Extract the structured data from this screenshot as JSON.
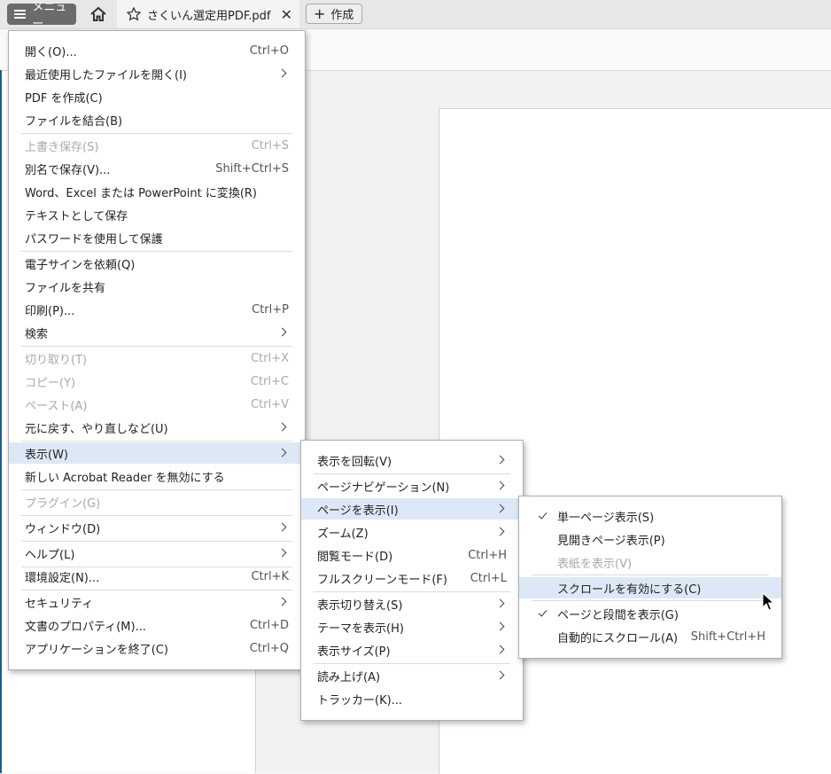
{
  "tabbar": {
    "menu_label": "メニュー",
    "tab_title": "さくいん選定用PDF.pdf",
    "close_glyph": "✕",
    "create_label": "作成",
    "create_plus": "+"
  },
  "main_menu": {
    "items": [
      {
        "label": "開く(O)...",
        "shortcut": "Ctrl+O"
      },
      {
        "label": "最近使用したファイルを開く(I)",
        "submenu": true
      },
      {
        "label": "PDF を作成(C)"
      },
      {
        "label": "ファイルを結合(B)"
      },
      {
        "label": "上書き保存(S)",
        "shortcut": "Ctrl+S",
        "disabled": true
      },
      {
        "label": "別名で保存(V)...",
        "shortcut": "Shift+Ctrl+S"
      },
      {
        "label": "Word、Excel または PowerPoint に変換(R)"
      },
      {
        "label": "テキストとして保存"
      },
      {
        "label": "パスワードを使用して保護"
      },
      {
        "label": "電子サインを依頼(Q)"
      },
      {
        "label": "ファイルを共有"
      },
      {
        "label": "印刷(P)...",
        "shortcut": "Ctrl+P"
      },
      {
        "label": "検索",
        "submenu": true
      },
      {
        "label": "切り取り(T)",
        "shortcut": "Ctrl+X",
        "disabled": true
      },
      {
        "label": "コピー(Y)",
        "shortcut": "Ctrl+C",
        "disabled": true
      },
      {
        "label": "ペースト(A)",
        "shortcut": "Ctrl+V",
        "disabled": true
      },
      {
        "label": "元に戻す、やり直しなど(U)",
        "submenu": true
      },
      {
        "label": "表示(W)",
        "submenu": true,
        "highlighted": true
      },
      {
        "label": "新しい Acrobat Reader を無効にする"
      },
      {
        "label": "プラグイン(G)",
        "disabled": true
      },
      {
        "label": "ウィンドウ(D)",
        "submenu": true
      },
      {
        "label": "ヘルプ(L)",
        "submenu": true
      },
      {
        "label": "環境設定(N)...",
        "shortcut": "Ctrl+K"
      },
      {
        "label": "セキュリティ",
        "submenu": true
      },
      {
        "label": "文書のプロパティ(M)...",
        "shortcut": "Ctrl+D"
      },
      {
        "label": "アプリケーションを終了(C)",
        "shortcut": "Ctrl+Q"
      }
    ]
  },
  "view_menu": {
    "items": [
      {
        "label": "表示を回転(V)",
        "submenu": true
      },
      {
        "label": "ページナビゲーション(N)",
        "submenu": true
      },
      {
        "label": "ページを表示(I)",
        "submenu": true,
        "highlighted": true
      },
      {
        "label": "ズーム(Z)",
        "submenu": true
      },
      {
        "label": "閲覧モード(D)",
        "shortcut": "Ctrl+H"
      },
      {
        "label": "フルスクリーンモード(F)",
        "shortcut": "Ctrl+L"
      },
      {
        "label": "表示切り替え(S)",
        "submenu": true
      },
      {
        "label": "テーマを表示(H)",
        "submenu": true
      },
      {
        "label": "表示サイズ(P)",
        "submenu": true
      },
      {
        "label": "読み上げ(A)",
        "submenu": true
      },
      {
        "label": "トラッカー(K)..."
      }
    ]
  },
  "page_display_menu": {
    "items": [
      {
        "label": "単一ページ表示(S)",
        "checked": true
      },
      {
        "label": "見開きページ表示(P)"
      },
      {
        "label": "表紙を表示(V)",
        "disabled": true
      },
      {
        "label": "スクロールを有効にする(C)",
        "highlighted": true
      },
      {
        "label": "ページと段間を表示(G)",
        "checked": true
      },
      {
        "label": "自動的にスクロール(A)",
        "shortcut": "Shift+Ctrl+H"
      }
    ]
  },
  "colors": {
    "highlight": "#dde8f7",
    "menu_button": "#6b6b6b",
    "disabled_text": "#a9a9a9"
  }
}
